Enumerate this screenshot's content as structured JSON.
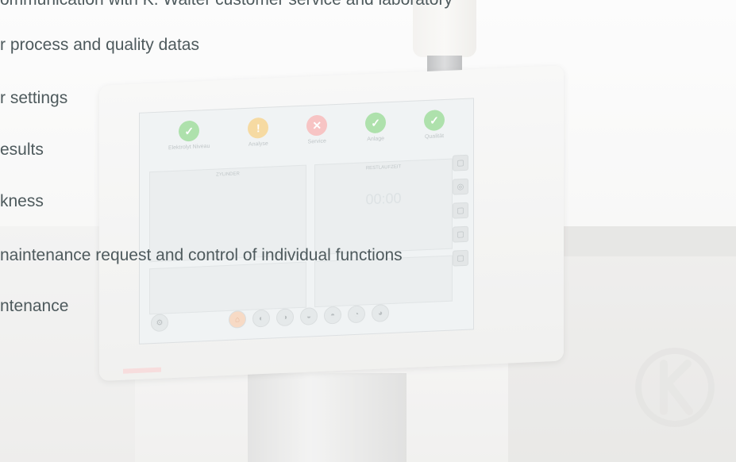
{
  "background_lines": [
    {
      "text": "ommunication with K. Walter customer service and laboratory"
    },
    {
      "text": "r process and quality datas"
    },
    {
      "text": "r settings"
    },
    {
      "text": "esults"
    },
    {
      "text": "kness"
    },
    {
      "text": "naintenance request and control of individual functions"
    },
    {
      "text": "ntenance"
    }
  ],
  "hmi": {
    "status": [
      {
        "label": "Elektrolyt Niveau",
        "symbol": "✓",
        "color": "#7ccf7a"
      },
      {
        "label": "Analyse",
        "symbol": "!",
        "color": "#f0c46a"
      },
      {
        "label": "Service",
        "symbol": "✕",
        "color": "#f2a0a0"
      },
      {
        "label": "Anlage",
        "symbol": "✓",
        "color": "#7ccf7a"
      },
      {
        "label": "Qualität",
        "symbol": "✓",
        "color": "#7ccf7a"
      }
    ],
    "left_pane_title": "ZYLINDER",
    "right_pane_title": "RESTLAUFZEIT",
    "timer": "00:00"
  },
  "icons": {
    "status_check": "check-icon",
    "status_warning": "warning-icon",
    "status_error": "error-icon",
    "home": "home-icon"
  }
}
